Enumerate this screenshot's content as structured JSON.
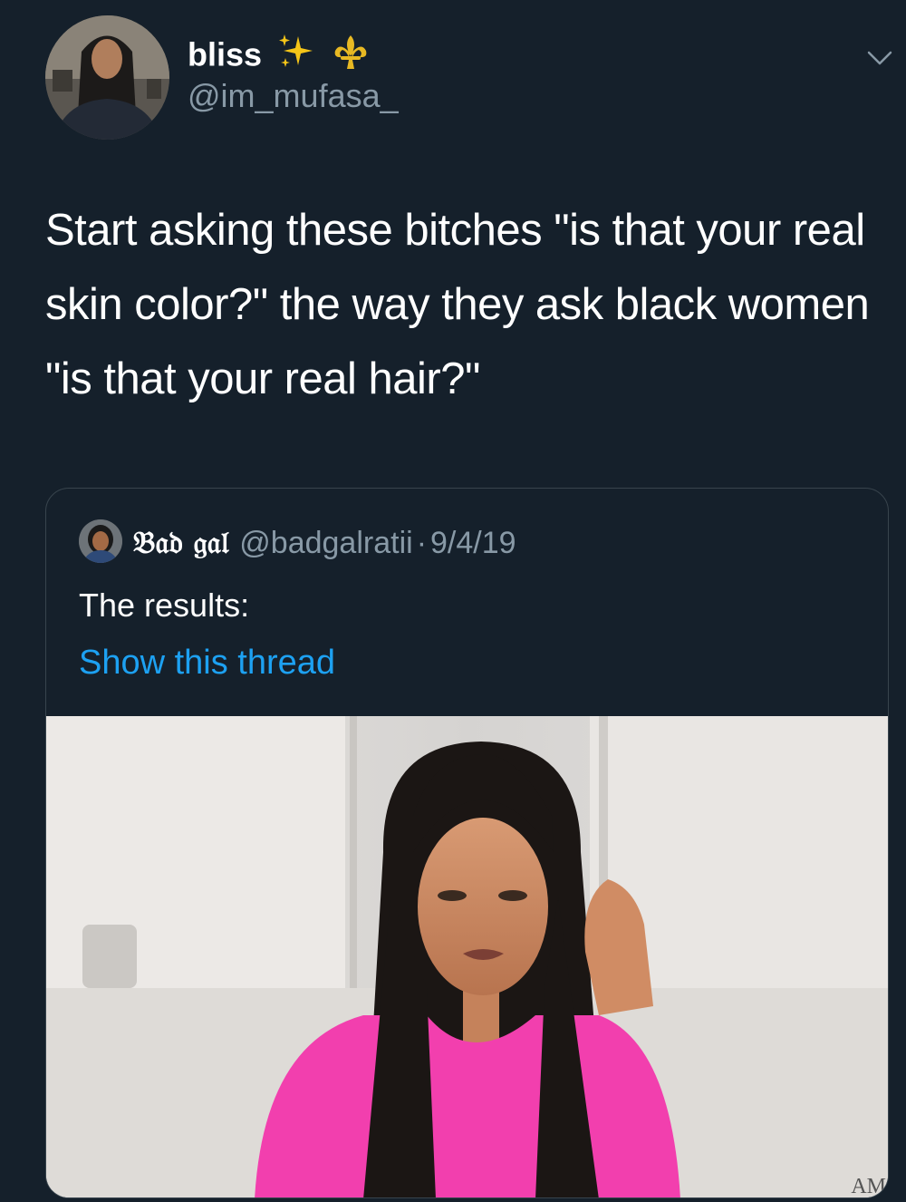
{
  "tweet": {
    "author": {
      "display_name": "bliss",
      "name_emojis": [
        "sparkles-emoji",
        "fleur-de-lis-emoji"
      ],
      "handle": "@im_mufasa_"
    },
    "text": "Start asking these bitches \"is that your real skin color?\" the way they ask black women \"is that your real hair?\"",
    "menu_icon": "chevron-down-icon",
    "quoted": {
      "display_name": "𝔅𝔞𝔡 𝔤𝔞𝔩",
      "handle": "@badgalratii",
      "separator": "·",
      "date": "9/4/19",
      "text": "The results:",
      "thread_link": "Show this thread",
      "media_watermark": "AM"
    }
  },
  "colors": {
    "background": "#15202b",
    "primary_text": "#ffffff",
    "secondary_text": "#8899a6",
    "link": "#1da1f2",
    "border": "#38444d",
    "sweater_pink": "#f23fae"
  }
}
